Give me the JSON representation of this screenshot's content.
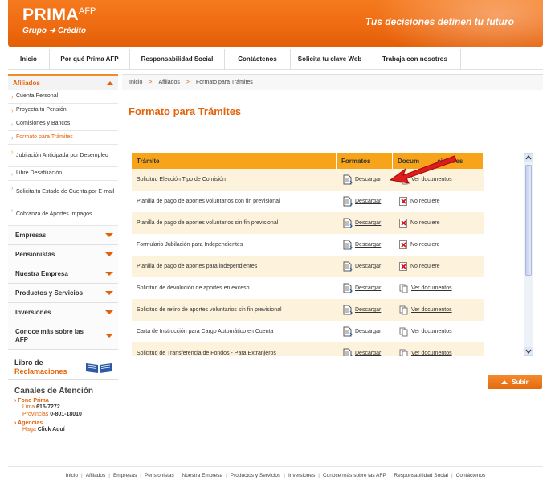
{
  "header": {
    "logo_main": "PRIMA",
    "logo_afp": "AFP",
    "logo_sub": "Grupo ➜ Crédito",
    "tagline": "Tus decisiones definen tu futuro"
  },
  "topnav": [
    "Inicio",
    "Por qué Prima AFP",
    "Responsabilidad Social",
    "Contáctenos",
    "Solicita tu clave Web",
    "Trabaja con nosotros"
  ],
  "sidebar": {
    "section_open": "Afiliados",
    "subitems": [
      "Cuenta Personal",
      "Proyecta tu Pensión",
      "Comisiones y Bancos",
      "Formato para Trámites",
      "Jubilación Anticipada por Desempleo",
      "Libre Desafiliación",
      "Solicita tu Estado de Cuenta por E-mail",
      "Cobranza de Aportes Impagos"
    ],
    "sections": [
      "Empresas",
      "Pensionistas",
      "Nuestra Empresa",
      "Productos y Servicios",
      "Inversiones",
      "Conoce más sobre las AFP"
    ],
    "libro_line1": "Libro de",
    "libro_line2": "Reclamaciones",
    "canales_title": "Canales de Atención",
    "fono_label": "Fono Prima",
    "fono_lima_label": "Lima",
    "fono_lima": "615-7272",
    "fono_prov_label": "Provincias",
    "fono_prov": "0-801-18010",
    "agencias_label": "Agencias",
    "agencias_text": "Haga",
    "agencias_link": "Click Aquí"
  },
  "breadcrumb": [
    "Inicio",
    ">",
    "Afiliados",
    ">",
    "Formato para Trámites"
  ],
  "page_title": "Formato para Trámites",
  "table": {
    "headers": [
      "Trámite",
      "Formatos",
      "Documentos Adicionales"
    ],
    "header3_visible": "Docum          cionales",
    "rows": [
      {
        "tramite": "Solicitud Elección Tipo de Comisión",
        "formato": "Descargar",
        "adicional": "Ver documentos",
        "tipo": "doc"
      },
      {
        "tramite": "Planilla de pago de aportes voluntarios con fin previsional",
        "formato": "Descargar",
        "adicional": "No requiere",
        "tipo": "none"
      },
      {
        "tramite": "Planilla de pago de aportes voluntarios sin fin previsional",
        "formato": "Descargar",
        "adicional": "No requiere",
        "tipo": "none"
      },
      {
        "tramite": "Formulario Jubilación para Independientes",
        "formato": "Descargar",
        "adicional": "No requiere",
        "tipo": "none"
      },
      {
        "tramite": "Planilla de pago de aportes para independientes",
        "formato": "Descargar",
        "adicional": "No requiere",
        "tipo": "none"
      },
      {
        "tramite": "Solicitud de devolución de aportes en exceso",
        "formato": "Descargar",
        "adicional": "Ver documentos",
        "tipo": "doc"
      },
      {
        "tramite": "Solicitud de retiro de aportes voluntarios sin fin previsional",
        "formato": "Descargar",
        "adicional": "Ver documentos",
        "tipo": "doc"
      },
      {
        "tramite": "Carta de Instrucción para Cargo Automático en Cuenta",
        "formato": "Descargar",
        "adicional": "Ver documentos",
        "tipo": "doc"
      },
      {
        "tramite": "Solicitud de Transferencia de Fondos - Para Extranjeros",
        "formato": "Descargar",
        "adicional": "Ver documentos",
        "tipo": "doc"
      }
    ]
  },
  "subir_label": "Subir",
  "footer": [
    "Inicio",
    "Afiliados",
    "Empresas",
    "Pensionistas",
    "Nuestra Empresa",
    "Productos y Servicios",
    "Inversiones",
    "Conoce más sobre las AFP",
    "Responsabilidad Social",
    "Contáctenos"
  ],
  "colors": {
    "brand_orange": "#ee6a10",
    "table_header": "#f7a41a",
    "accent_text": "#e2620a",
    "arrow_red": "#e01b1b"
  }
}
